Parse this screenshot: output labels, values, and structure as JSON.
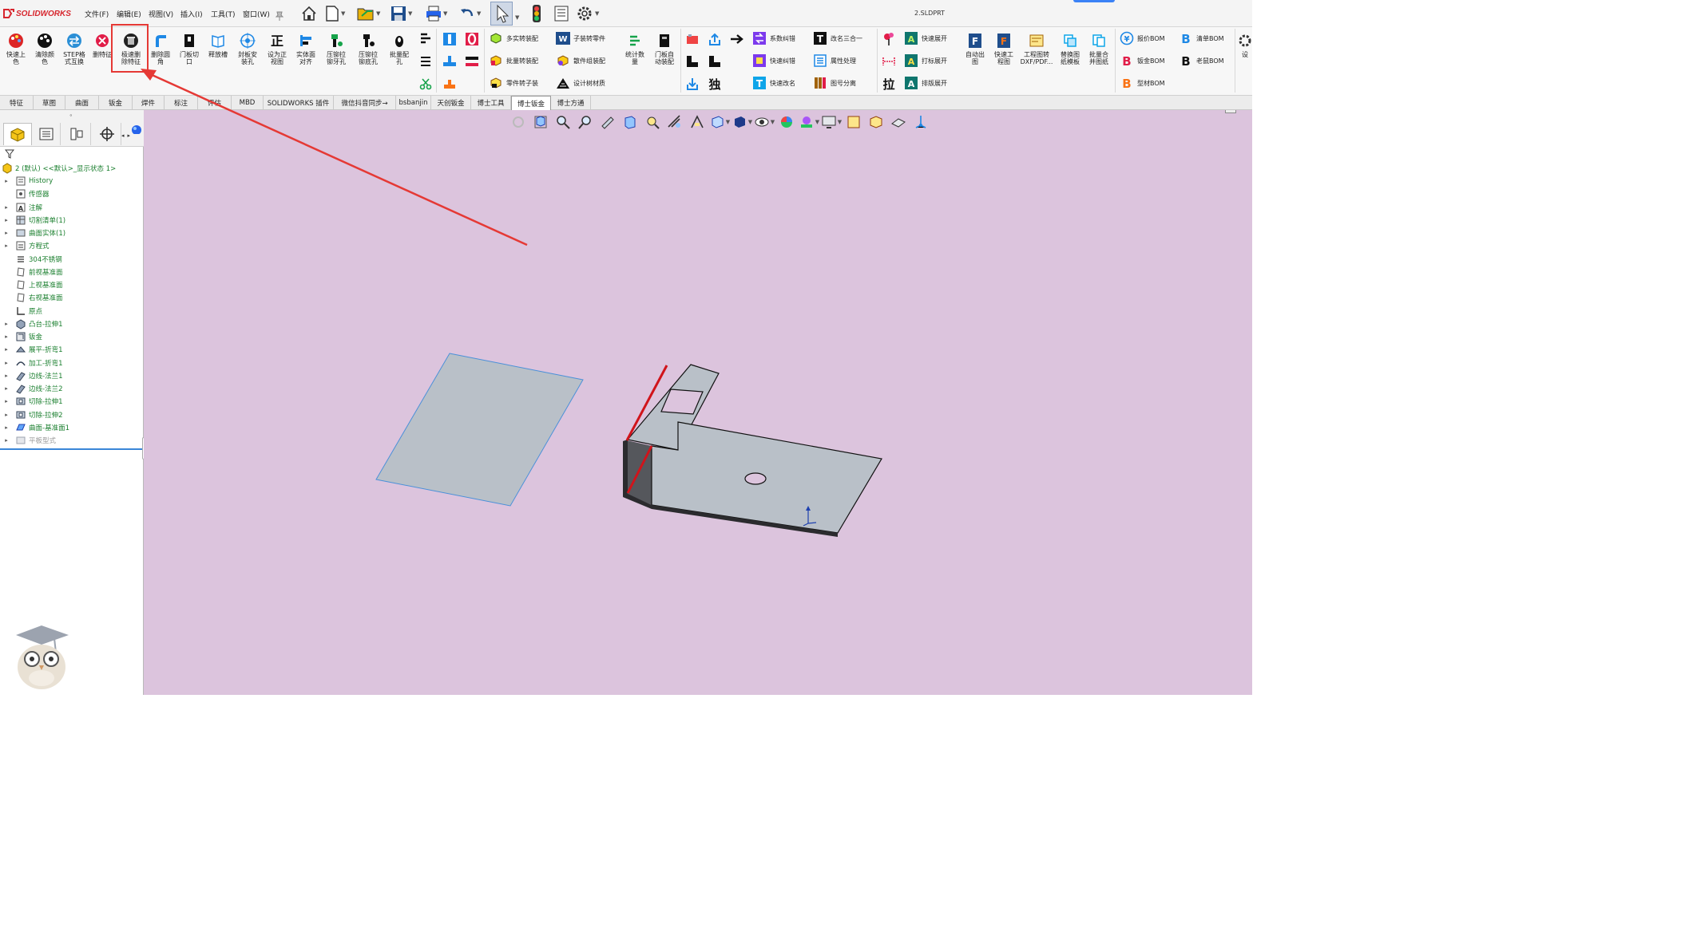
{
  "app": {
    "logo_text": "SOLIDWORKS",
    "document_title": "2.SLDPRT",
    "menus": [
      "文件(F)",
      "编辑(E)",
      "视图(V)",
      "插入(I)",
      "工具(T)",
      "窗口(W)"
    ]
  },
  "ribbon": {
    "main_buttons": [
      {
        "label": "快速上\n色",
        "icon": "paint-palette-red-icon"
      },
      {
        "label": "清除颜\n色",
        "icon": "paint-palette-dark-icon"
      },
      {
        "label": "STEP格\n式互换",
        "icon": "step-swap-icon"
      },
      {
        "label": "删特征",
        "icon": "delete-x-icon"
      },
      {
        "label": "极速删\n除特征",
        "icon": "trash-can-icon"
      },
      {
        "label": "删除圆\n角",
        "icon": "delete-fillet-icon"
      },
      {
        "label": "门板切\n口",
        "icon": "door-cut-icon"
      },
      {
        "label": "释放槽",
        "icon": "relief-slot-icon"
      },
      {
        "label": "封板安\n装孔",
        "icon": "mount-hole-icon"
      },
      {
        "label": "设为正\n视图",
        "icon": "normal-view-icon"
      },
      {
        "label": "实体面\n对齐",
        "icon": "face-align-icon"
      },
      {
        "label": "压铆拉\n铆牙孔",
        "icon": "rivet-thread-hole-icon"
      },
      {
        "label": "压铆拉\n铆底孔",
        "icon": "rivet-base-hole-icon"
      },
      {
        "label": "批量配\n孔",
        "icon": "batch-hole-icon"
      }
    ],
    "group2": [
      {
        "label": "多实转装配",
        "icon": "multibody-to-assembly-icon"
      },
      {
        "label": "批量转装配",
        "icon": "batch-to-assembly-icon"
      },
      {
        "label": "零件转子装",
        "icon": "part-to-subassembly-icon"
      }
    ],
    "group3": [
      {
        "label": "子装转零件",
        "icon": "subassembly-to-part-icon"
      },
      {
        "label": "散件组装配",
        "icon": "loose-parts-assembly-icon"
      },
      {
        "label": "设计树材质",
        "icon": "tree-material-icon"
      }
    ],
    "group4": [
      {
        "label": "统计数\n量",
        "icon": "count-stats-icon"
      },
      {
        "label": "门板自\n动装配",
        "icon": "door-auto-assembly-icon"
      }
    ],
    "group5": [
      {
        "label": "系数纠错",
        "icon": "coefficient-fix-icon"
      },
      {
        "label": "快速纠错",
        "icon": "quick-fix-icon"
      },
      {
        "label": "快速改名",
        "icon": "quick-rename-icon"
      }
    ],
    "group6": [
      {
        "label": "改名三合一",
        "icon": "rename-3in1-icon"
      },
      {
        "label": "属性处理",
        "icon": "property-icon"
      },
      {
        "label": "图号分离",
        "icon": "drawing-number-split-icon"
      }
    ],
    "group7": [
      {
        "label": "快速展开",
        "icon": "quick-unfold-icon"
      },
      {
        "label": "打标展开",
        "icon": "mark-unfold-icon"
      },
      {
        "label": "排版展开",
        "icon": "layout-unfold-icon"
      }
    ],
    "group8": [
      {
        "label": "自动出\n图",
        "icon": "auto-drawing-icon"
      },
      {
        "label": "快速工\n程图",
        "icon": "quick-drawing-icon"
      },
      {
        "label": "工程图转\nDXF/PDF...",
        "icon": "drawing-to-dxf-icon"
      },
      {
        "label": "替换图\n纸模板",
        "icon": "replace-template-icon"
      },
      {
        "label": "批量合\n并图纸",
        "icon": "merge-drawings-icon"
      }
    ],
    "group9": [
      {
        "label": "报价BOM",
        "icon": "quote-bom-icon"
      },
      {
        "label": "钣金BOM",
        "icon": "sheetmetal-bom-icon"
      },
      {
        "label": "型材BOM",
        "icon": "profile-bom-icon"
      }
    ],
    "group10": [
      {
        "label": "清单BOM",
        "icon": "list-bom-icon"
      },
      {
        "label": "老鼠BOM",
        "icon": "mouse-bom-icon"
      }
    ],
    "last": {
      "label": "设",
      "icon": "settings-icon"
    },
    "glyph_dokou": "独",
    "glyph_la": "拉"
  },
  "tabs": [
    "特征",
    "草图",
    "曲面",
    "钣金",
    "焊件",
    "标注",
    "评估",
    "MBD",
    "SOLIDWORKS 插件",
    "微信抖音同步→",
    "bsbanjin",
    "天创钣金",
    "博士工具",
    "博士钣金",
    "博士方通"
  ],
  "active_tab_index": 13,
  "tree": {
    "root": "2 (默认) <<默认>_显示状态 1>",
    "items": [
      {
        "label": "History",
        "expand": true,
        "icon": "history-icon",
        "muted": false
      },
      {
        "label": "传感器",
        "expand": false,
        "icon": "sensor-icon",
        "muted": false
      },
      {
        "label": "注解",
        "expand": true,
        "icon": "annotation-icon",
        "muted": false
      },
      {
        "label": "切割清单(1)",
        "expand": true,
        "icon": "cutlist-icon",
        "muted": false
      },
      {
        "label": "曲面实体(1)",
        "expand": true,
        "icon": "surface-body-icon",
        "muted": false
      },
      {
        "label": "方程式",
        "expand": true,
        "icon": "equation-icon",
        "muted": false
      },
      {
        "label": "304不锈钢",
        "expand": false,
        "icon": "material-icon",
        "muted": false
      },
      {
        "label": "前视基准面",
        "expand": false,
        "icon": "plane-icon",
        "muted": false
      },
      {
        "label": "上视基准面",
        "expand": false,
        "icon": "plane-icon",
        "muted": false
      },
      {
        "label": "右视基准面",
        "expand": false,
        "icon": "plane-icon",
        "muted": false
      },
      {
        "label": "原点",
        "expand": false,
        "icon": "origin-icon",
        "muted": false
      },
      {
        "label": "凸台-拉伸1",
        "expand": true,
        "icon": "extrude-icon",
        "muted": false
      },
      {
        "label": "钣金",
        "expand": true,
        "icon": "sheetmetal-icon",
        "muted": false
      },
      {
        "label": "展平-折弯1",
        "expand": true,
        "icon": "flatten-bend-icon",
        "muted": false
      },
      {
        "label": "加工-折弯1",
        "expand": true,
        "icon": "process-bend-icon",
        "muted": false
      },
      {
        "label": "边线-法兰1",
        "expand": true,
        "icon": "edge-flange-icon",
        "muted": false
      },
      {
        "label": "边线-法兰2",
        "expand": true,
        "icon": "edge-flange-icon",
        "muted": false
      },
      {
        "label": "切除-拉伸1",
        "expand": true,
        "icon": "cut-extrude-icon",
        "muted": false
      },
      {
        "label": "切除-拉伸2",
        "expand": true,
        "icon": "cut-extrude-icon",
        "muted": false
      },
      {
        "label": "曲面-基准面1",
        "expand": true,
        "icon": "surface-plane-icon",
        "muted": false
      },
      {
        "label": "平板型式",
        "expand": true,
        "icon": "flat-pattern-icon",
        "muted": true
      }
    ]
  },
  "colors": {
    "viewport_bg": "#dcc4dd",
    "highlight": "#e53935",
    "tree_text": "#1a7f2e",
    "part_face": "#b9c0c8",
    "part_edge_red": "#d0141b"
  }
}
